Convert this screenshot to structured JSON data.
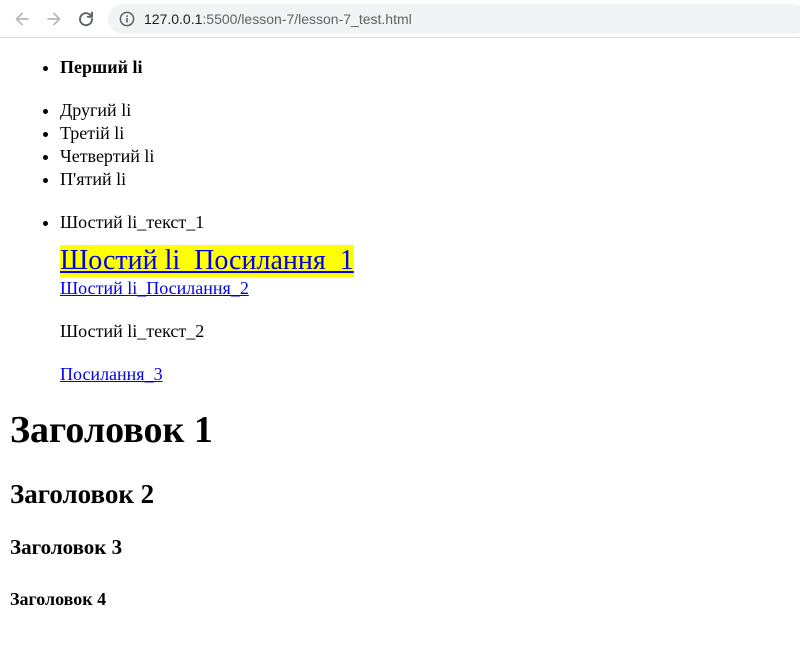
{
  "browser": {
    "url_host": "127.0.0.1",
    "url_rest": ":5500/lesson-7/lesson-7_test.html",
    "icons": {
      "back": "arrow-left-icon",
      "forward": "arrow-right-icon",
      "reload": "reload-icon",
      "site_info": "info-icon"
    }
  },
  "page": {
    "list": {
      "item1": "Перший li",
      "item2": "Другий li",
      "item3": "Третій li",
      "item4": "Четвертий li",
      "item5": "П'ятий li",
      "item6": {
        "text_1": "Шостий li_текст_1",
        "link_1": "Шостий li_Посилання_1",
        "link_2": "Шостий li_Посилання_2",
        "text_2": "Шостий li_текст_2",
        "link_3": "Посилання_3"
      }
    },
    "headings": {
      "h1": "Заголовок 1",
      "h2": "Заголовок 2",
      "h3": "Заголовок 3",
      "h4": "Заголовок 4"
    }
  },
  "colors": {
    "link": "#0000ee",
    "highlight": "#ffff00"
  }
}
